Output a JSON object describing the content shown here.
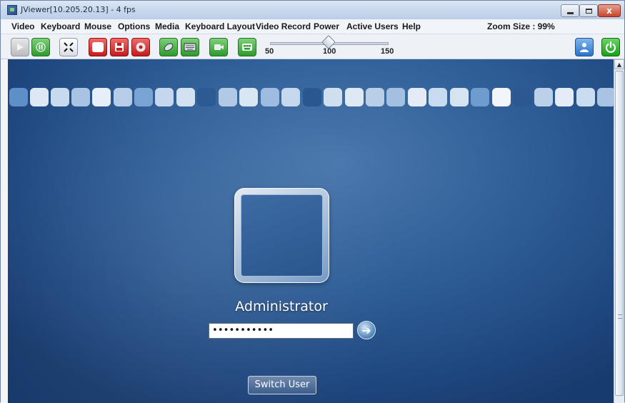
{
  "window": {
    "title": "JViewer[10.205.20.13] - 4 fps",
    "buttons": {
      "minimize": "minimize",
      "maximize": "maximize",
      "close": "x"
    }
  },
  "menu": {
    "items": [
      "Video",
      "Keyboard",
      "Mouse",
      "Options",
      "Media",
      "Keyboard Layout",
      "Video Record",
      "Power",
      "Active Users",
      "Help"
    ],
    "zoom_label": "Zoom Size : 99%"
  },
  "toolbar": {
    "icons": [
      "play-icon",
      "pause-icon",
      "fullscreen-icon",
      "cd-icon",
      "floppy-icon",
      "hard-disk-icon",
      "mouse-icon",
      "keyboard-icon",
      "video-record-icon",
      "hotkeys-icon",
      "active-user-icon",
      "power-icon"
    ],
    "zoom_slider": {
      "value": 100,
      "min": 50,
      "max": 150,
      "ticks": [
        "50",
        "100",
        "150"
      ]
    }
  },
  "remote_screen": {
    "username": "Administrator",
    "password_masked": "•••••••••••",
    "switch_user_label": "Switch User",
    "go_arrow": "➔"
  },
  "colors": {
    "screen_bg": "#2f5e97",
    "menu_bg": "#f1f4f9",
    "title_bg": "#c9d8ec"
  }
}
